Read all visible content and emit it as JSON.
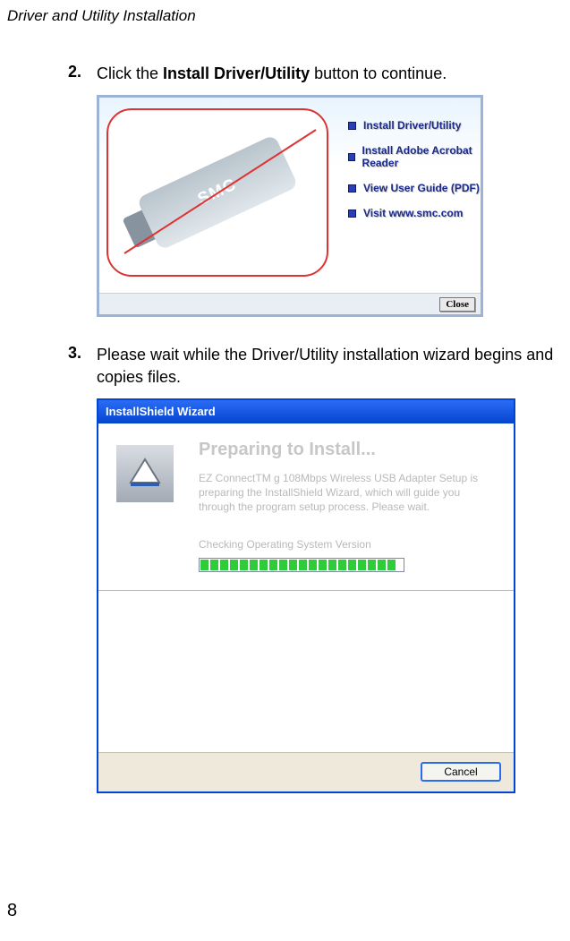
{
  "header": {
    "title": "Driver and Utility Installation"
  },
  "steps": {
    "s2": {
      "num": "2.",
      "pre": "Click the ",
      "bold": "Install Driver/Utility",
      "post": " button to continue."
    },
    "s3": {
      "num": "3.",
      "text": "Please wait while the Driver/Utility installation wizard begins and copies files."
    }
  },
  "autorun": {
    "logo": "SMC",
    "items": [
      "Install Driver/Utility",
      "Install Adobe Acrobat Reader",
      "View User Guide (PDF)",
      "Visit www.smc.com"
    ],
    "close": "Close"
  },
  "wizard": {
    "titlebar": "InstallShield Wizard",
    "heading": "Preparing to Install...",
    "body": "EZ ConnectTM g 108Mbps Wireless USB Adapter Setup is preparing the InstallShield Wizard, which will guide you through the program setup process.  Please wait.",
    "status": "Checking Operating System Version",
    "cancel": "Cancel"
  },
  "page": {
    "number": "8"
  }
}
